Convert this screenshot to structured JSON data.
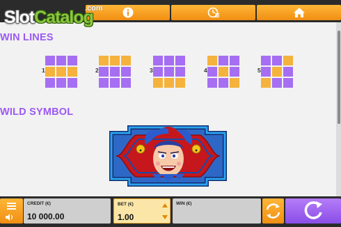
{
  "watermark": {
    "brand": "SlotCatalog",
    "brand_part1": "Slot",
    "brand_part2": "Catalog",
    "tld": ".com"
  },
  "topbar": {
    "tabs": [
      {
        "name": "info",
        "icon": "info-icon"
      },
      {
        "name": "history",
        "icon": "history-icon"
      },
      {
        "name": "home",
        "icon": "home-icon"
      }
    ]
  },
  "win_lines": {
    "title": "WIN LINES",
    "lines": [
      {
        "number": "1",
        "pattern": [
          [
            0,
            0,
            0
          ],
          [
            1,
            1,
            1
          ],
          [
            0,
            0,
            0
          ]
        ]
      },
      {
        "number": "2",
        "pattern": [
          [
            1,
            1,
            1
          ],
          [
            0,
            0,
            0
          ],
          [
            0,
            0,
            0
          ]
        ]
      },
      {
        "number": "3",
        "pattern": [
          [
            0,
            0,
            0
          ],
          [
            0,
            0,
            0
          ],
          [
            1,
            1,
            1
          ]
        ]
      },
      {
        "number": "4",
        "pattern": [
          [
            1,
            0,
            0
          ],
          [
            0,
            1,
            0
          ],
          [
            0,
            0,
            1
          ]
        ]
      },
      {
        "number": "5",
        "pattern": [
          [
            0,
            0,
            1
          ],
          [
            0,
            1,
            0
          ],
          [
            1,
            0,
            0
          ]
        ]
      }
    ]
  },
  "wild_symbol": {
    "title": "WILD SYMBOL",
    "image": "jester-wild-icon"
  },
  "bottombar": {
    "credit_label": "CREDIT (€)",
    "credit_value": "10 000.00",
    "bet_label": "BET (€)",
    "bet_value": "1.00",
    "win_label": "WIN (€)",
    "win_value": ""
  },
  "colors": {
    "accent_orange": "#f5a623",
    "line_purple": "#a66ef2",
    "line_gold": "#f5b23c",
    "title_purple": "#9b59f2",
    "spin_purple": "#9a5ef0"
  }
}
